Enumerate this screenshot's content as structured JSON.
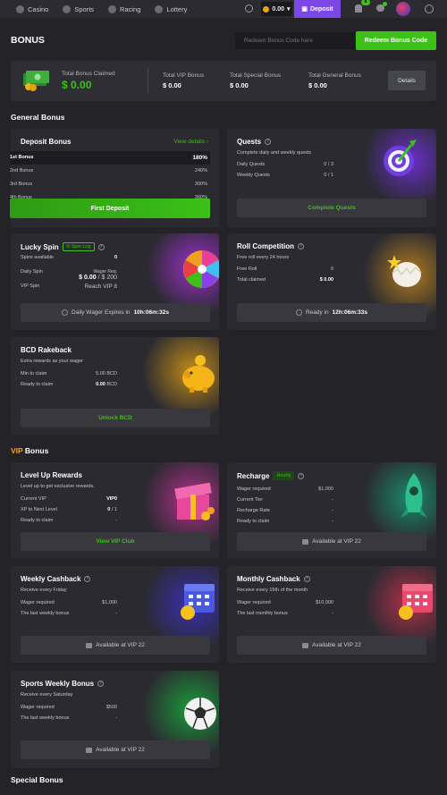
{
  "nav": {
    "items": [
      {
        "label": "Casino",
        "icon": "casino-icon"
      },
      {
        "label": "Sports",
        "icon": "sports-icon"
      },
      {
        "label": "Racing",
        "icon": "racing-icon"
      },
      {
        "label": "Lottery",
        "icon": "lottery-icon"
      }
    ],
    "balance": "0.00",
    "deposit_label": "Deposit",
    "notification_count": "8"
  },
  "page": {
    "title": "BONUS",
    "code_placeholder": "Redeem Bonus Code here",
    "redeem_label": "Redeem Bonus Code"
  },
  "summary": {
    "claimed_label": "Total Bonus Claimed",
    "claimed_value": "$ 0.00",
    "vip_label": "Total VIP Bonus",
    "vip_value": "$ 0.00",
    "special_label": "Total Special Bonus",
    "special_value": "$ 0.00",
    "general_label": "Total General Bonus",
    "general_value": "$ 0.00",
    "details_label": "Details"
  },
  "sections": {
    "general": "General Bonus",
    "vip_accent": "VIP",
    "vip_rest": " Bonus",
    "special": "Special Bonus"
  },
  "deposit": {
    "title": "Deposit Bonus",
    "view_details": "View details",
    "rows": [
      {
        "label": "1st Bonus",
        "pct": "180%"
      },
      {
        "label": "2nd Bonus",
        "pct": "240%"
      },
      {
        "label": "3rd Bonus",
        "pct": "300%"
      },
      {
        "label": "4th Bonus",
        "pct": "360%"
      }
    ],
    "button": "First Deposit"
  },
  "quests": {
    "title": "Quests",
    "subtitle": "Complete daily and weekly quests",
    "daily_label": "Daily Quests",
    "daily_value": "0 / 3",
    "weekly_label": "Weekly Quests",
    "weekly_value": "0 / 1",
    "button": "Complete Quests"
  },
  "lucky_spin": {
    "title": "Lucky Spin",
    "tag": "Spin Log",
    "spins_label": "Spins available",
    "spins_value": "0",
    "daily_label": "Daily Spin",
    "wager_req_label": "Wager Req.",
    "daily_value_a": "$ 0.00",
    "daily_value_b": " / $ 200",
    "vip_label": "VIP Spin",
    "vip_value": "Reach VIP 8",
    "expires_label": "Daily Wager Expires in",
    "expires_value": "10h:06m:32s"
  },
  "roll": {
    "title": "Roll Competition",
    "subtitle": "Free roll every 24 hours",
    "free_label": "Free Roll",
    "free_value": "0",
    "claimed_label": "Total claimed",
    "claimed_value": "$ 0.00",
    "ready_label": "Ready in",
    "ready_value": "12h:06m:33s"
  },
  "rakeback": {
    "title": "BCD Rakeback",
    "subtitle": "Extra rewards as your wager",
    "min_label": "Min to claim",
    "min_value": "5.00 BCD",
    "ready_label": "Ready to claim",
    "ready_value_a": "0.00",
    "ready_value_b": " BCD",
    "button": "Unlock BCD"
  },
  "level_up": {
    "title": "Level Up Rewards",
    "subtitle": "Level up to get exclusive rewards.",
    "vip_label": "Current VIP",
    "vip_value": "VIP0",
    "xp_label": "XP to Next Level",
    "xp_value_a": "0",
    "xp_value_b": " / 1",
    "ready_label": "Ready to claim",
    "ready_value": "-",
    "button": "View VIP Club"
  },
  "recharge": {
    "title": "Recharge",
    "tag": "Hourly",
    "wager_label": "Wager required",
    "wager_value": "$1,000",
    "tier_label": "Current Tier",
    "tier_value": "-",
    "rate_label": "Recharge Rate",
    "rate_value": "-",
    "ready_label": "Ready to claim",
    "ready_value": "-",
    "button": "Available at VIP 22"
  },
  "weekly": {
    "title": "Weekly Cashback",
    "subtitle": "Receive every Friday",
    "wager_label": "Wager required",
    "wager_value": "$1,000",
    "last_label": "The last weekly bonus",
    "last_value": "-",
    "button": "Available at VIP 22"
  },
  "monthly": {
    "title": "Monthly Cashback",
    "subtitle": "Receive every 15th of the month",
    "wager_label": "Wager required",
    "wager_value": "$10,000",
    "last_label": "The last monthly bonus",
    "last_value": "-",
    "button": "Available at VIP 22"
  },
  "sports": {
    "title": "Sports Weekly Bonus",
    "subtitle": "Receive every Saturday",
    "wager_label": "Wager required",
    "wager_value": "$500",
    "last_label": "The last weekly bonus",
    "last_value": "-",
    "button": "Available at VIP 22"
  },
  "colors": {
    "accent_green": "#3bc117",
    "deposit_purple": "#7b47e6",
    "vip_orange": "#f0a020",
    "background": "#232328",
    "card": "#2a2a30"
  }
}
